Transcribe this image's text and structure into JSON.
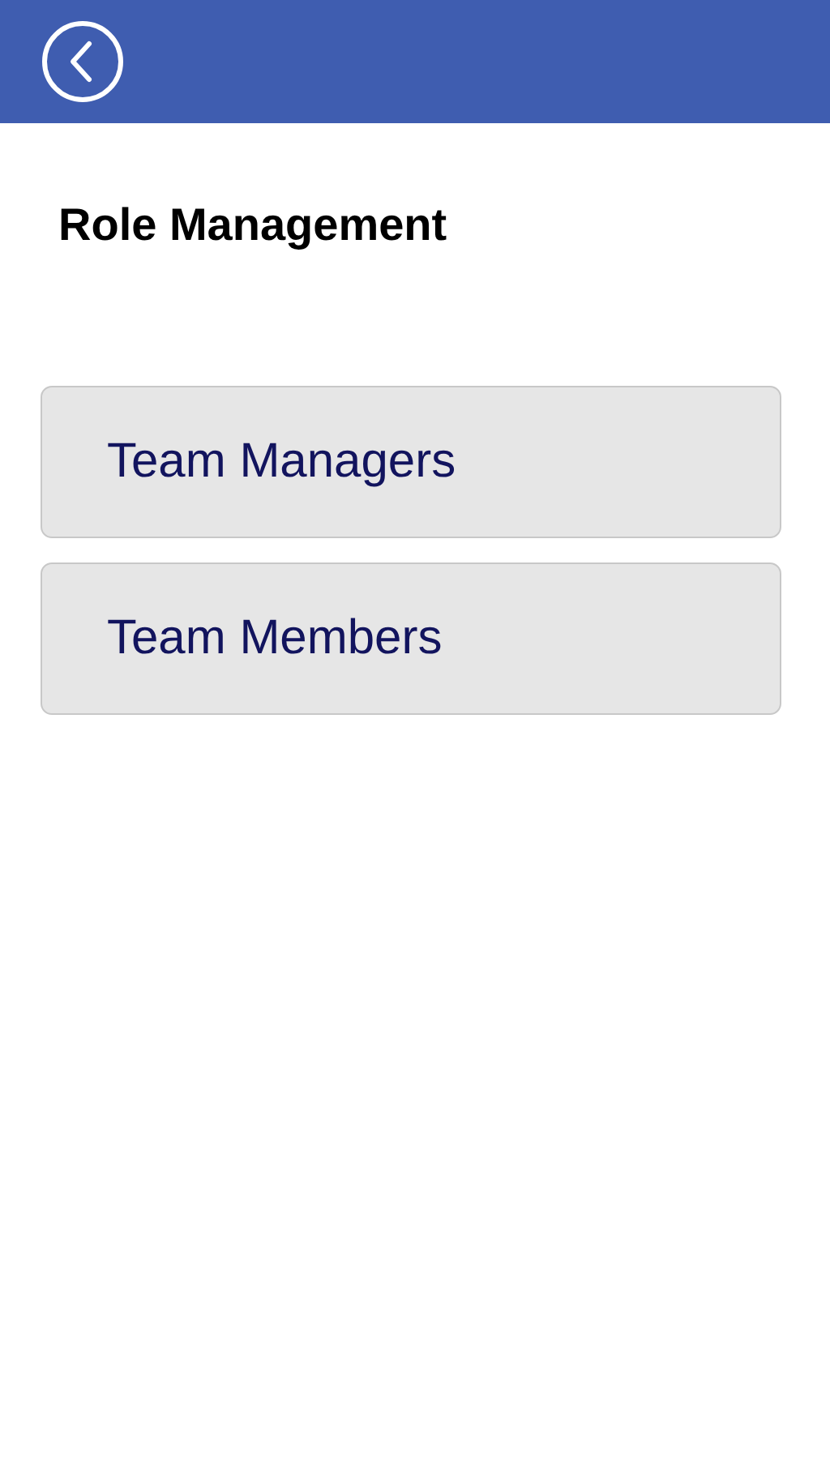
{
  "title": "Role Management",
  "buttons": [
    {
      "label": "Team Managers"
    },
    {
      "label": "Team Members"
    }
  ]
}
